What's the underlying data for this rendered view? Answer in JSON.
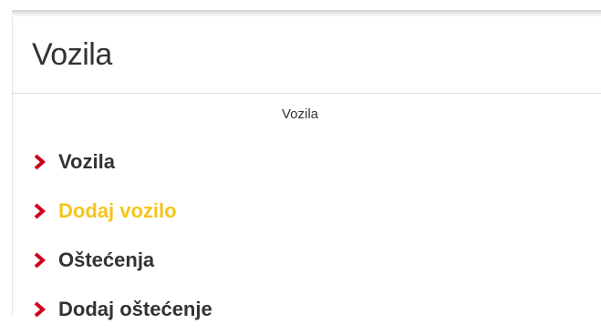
{
  "header": {
    "title": "Vozila"
  },
  "section": {
    "caption": "Vozila"
  },
  "menu": {
    "items": [
      {
        "label": "Vozila",
        "active": false
      },
      {
        "label": "Dodaj vozilo",
        "active": true
      },
      {
        "label": "Oštećenja",
        "active": false
      },
      {
        "label": "Dodaj oštećenje",
        "active": false
      }
    ]
  },
  "colors": {
    "chevron": "#d0021b",
    "active_item": "#f5c518",
    "text": "#333333"
  },
  "icons": {
    "bullet": "chevron-right-icon"
  }
}
